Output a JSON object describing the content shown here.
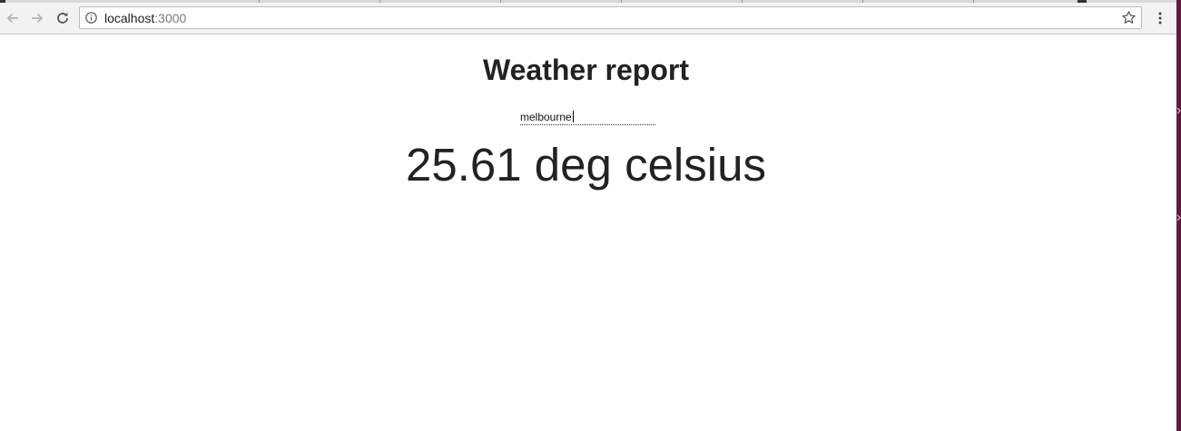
{
  "browser": {
    "url_host": "localhost",
    "url_port": ":3000",
    "icons": {
      "back": "back-arrow-icon",
      "forward": "forward-arrow-icon",
      "reload": "reload-icon",
      "info": "info-icon",
      "bookmark": "star-icon",
      "menu": "kebab-menu-icon"
    }
  },
  "page": {
    "title": "Weather report",
    "city_input_value": "melbourne",
    "temperature_text": "25.61 deg celsius"
  },
  "colors": {
    "desktop_edge": "#5c1a43",
    "toolbar_bg": "#f2f2f2",
    "text": "#222222"
  }
}
